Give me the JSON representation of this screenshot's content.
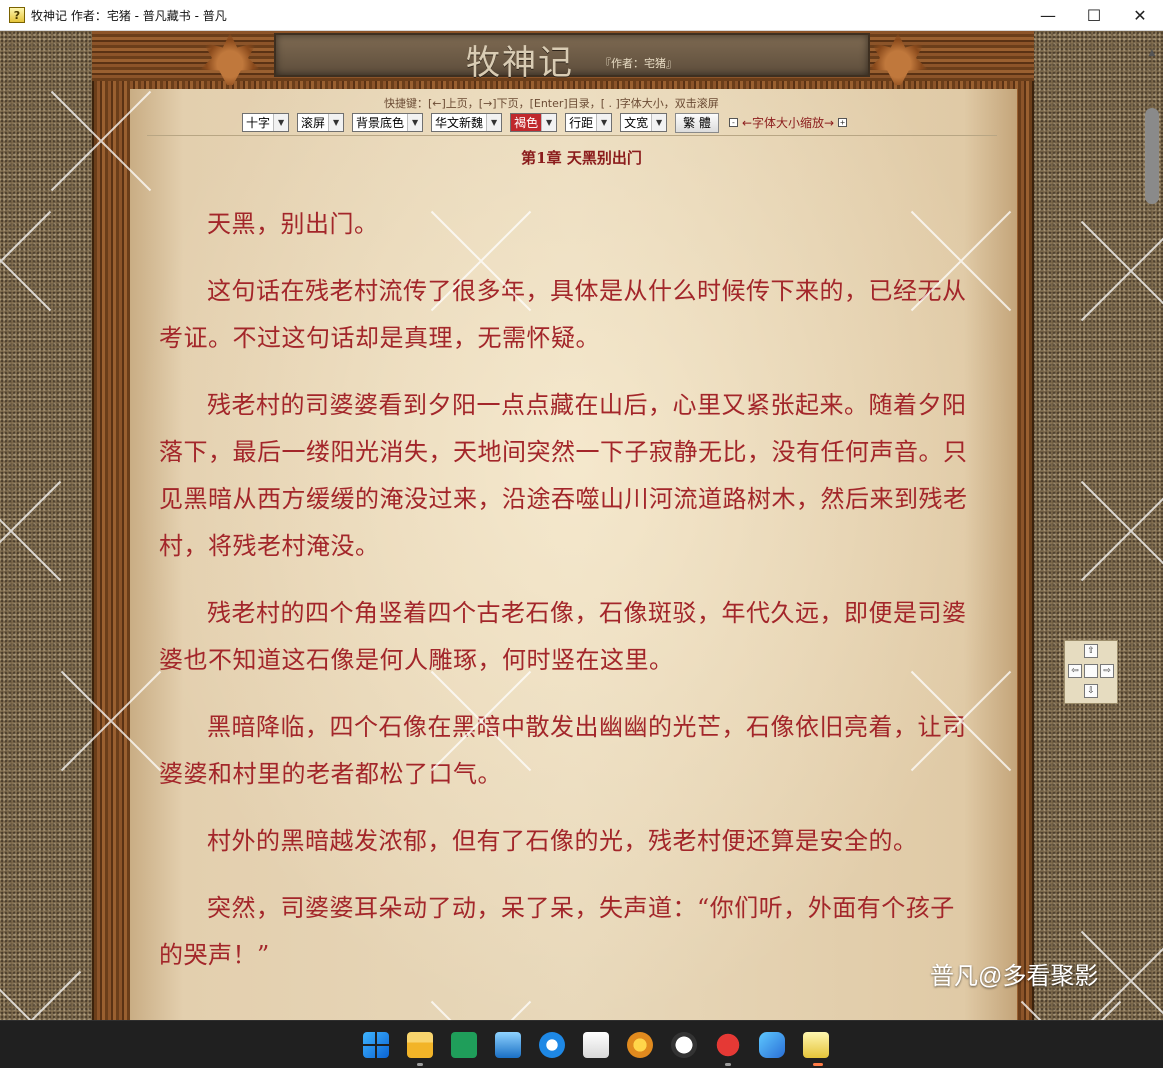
{
  "window": {
    "title": "牧神记 作者：宅猪 - 普凡藏书 - 普凡",
    "app_icon": "?",
    "minimize_glyph": "—",
    "maximize_glyph": "☐",
    "close_glyph": "✕"
  },
  "book": {
    "title": "牧神记",
    "author_line": "『作者：宅猪』"
  },
  "toolbar": {
    "hotkeys": "快捷键：[←]上页，[→]下页，[Enter]目录，[ . ]字体大小，双击滚屏",
    "selects": [
      {
        "name": "font-size-select",
        "value": "十字"
      },
      {
        "name": "scroll-select",
        "value": "滚屏"
      },
      {
        "name": "background-select",
        "value": "背景底色"
      },
      {
        "name": "font-family-select",
        "value": "华文新魏"
      },
      {
        "name": "text-color-select",
        "value": "褐色",
        "highlighted": true
      },
      {
        "name": "line-spacing-select",
        "value": "行距"
      },
      {
        "name": "text-width-select",
        "value": "文宽"
      }
    ],
    "convert_button": "繁 體",
    "zoom_minus": "-",
    "zoom_label": "←字体大小缩放→",
    "zoom_plus": "+"
  },
  "chapter": {
    "title": "第1章  天黑别出门",
    "paragraphs": [
      "天黑，别出门。",
      "这句话在残老村流传了很多年，具体是从什么时候传下来的，已经无从考证。不过这句话却是真理，无需怀疑。",
      "残老村的司婆婆看到夕阳一点点藏在山后，心里又紧张起来。随着夕阳落下，最后一缕阳光消失，天地间突然一下子寂静无比，没有任何声音。只见黑暗从西方缓缓的淹没过来，沿途吞噬山川河流道路树木，然后来到残老村，将残老村淹没。",
      "残老村的四个角竖着四个古老石像，石像斑驳，年代久远，即便是司婆婆也不知道这石像是何人雕琢，何时竖在这里。",
      "黑暗降临，四个石像在黑暗中散发出幽幽的光芒，石像依旧亮着，让司婆婆和村里的老者都松了口气。",
      "村外的黑暗越发浓郁，但有了石像的光，残老村便还算是安全的。",
      "突然，司婆婆耳朵动了动，呆了呆，失声道：“你们听，外面有个孩子的哭声！”"
    ]
  },
  "navpad": {
    "up": "⇧",
    "left": "⇦",
    "right": "⇨",
    "down": "⇩"
  },
  "watermark": {
    "text": "普凡@多看聚影"
  },
  "colors": {
    "text": "#a3262a",
    "title_bar": "#ffffff",
    "taskbar": "#202020"
  },
  "taskbar": {
    "icons": [
      "windows-start-icon",
      "file-explorer-icon",
      "spreadsheet-icon",
      "photos-icon",
      "browser-icon",
      "notepad-icon",
      "paint-icon",
      "hazard-app-icon",
      "media-player-icon",
      "cloud-app-icon",
      "help-reader-icon"
    ]
  }
}
